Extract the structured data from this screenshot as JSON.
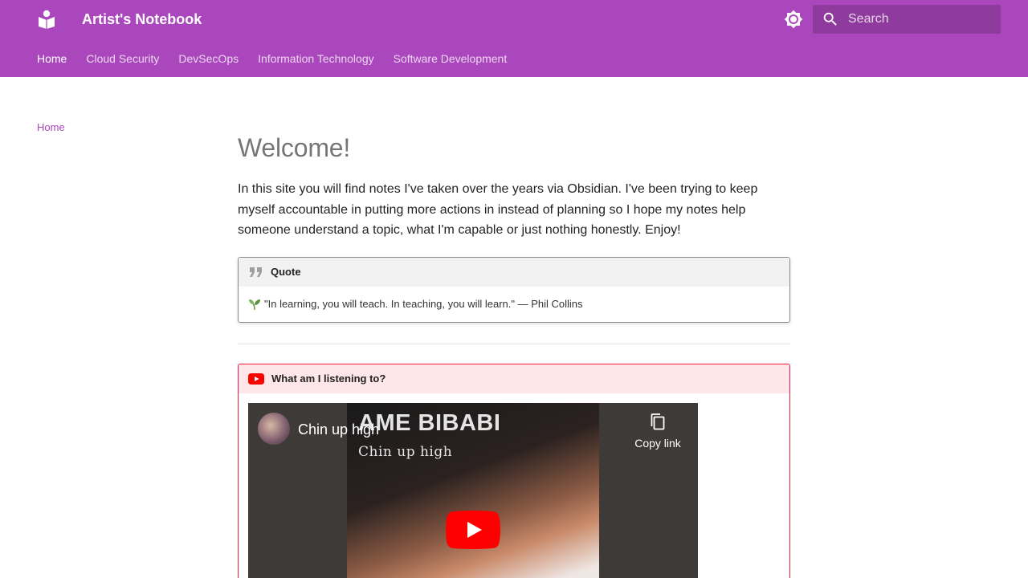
{
  "header": {
    "site_title": "Artist's Notebook",
    "logo_icon": "book-open-icon",
    "theme_toggle_icon": "brightness-icon",
    "search": {
      "placeholder": "Search",
      "icon": "search-icon"
    },
    "color": "#ab47bc"
  },
  "tabs": [
    {
      "label": "Home",
      "active": true
    },
    {
      "label": "Cloud Security"
    },
    {
      "label": "DevSecOps"
    },
    {
      "label": "Information Technology"
    },
    {
      "label": "Software Development"
    }
  ],
  "sidebar": {
    "home_label": "Home"
  },
  "main": {
    "title": "Welcome!",
    "intro": "In this site you will find notes I've taken over the years via Obsidian. I've been trying to keep myself accountable in putting more actions in instead of planning so I hope my notes help someone understand a topic, what I'm capable or just nothing honestly. Enjoy!",
    "quote": {
      "title": "Quote",
      "text": "\"In learning, you will teach. In teaching, you will learn.\" — Phil Collins",
      "emoji": "🌱"
    },
    "listening": {
      "title": "What am I listening to?",
      "video": {
        "title": "Chin up high",
        "art_title": "AME BIBABI",
        "art_subtitle": "Chin up high",
        "copy_label": "Copy link"
      }
    }
  },
  "colors": {
    "accent": "#ab47bc",
    "youtube_red": "#ff0000",
    "youtube_border": "#ff1744"
  }
}
